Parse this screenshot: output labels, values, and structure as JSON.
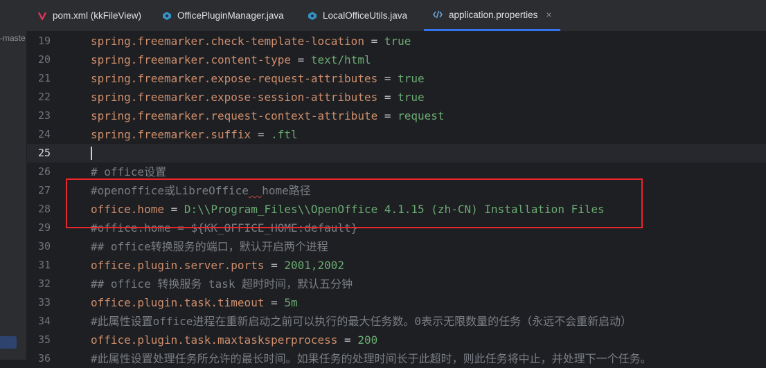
{
  "sidebar": {
    "project_label": "-maste"
  },
  "tabs": [
    {
      "label": "pom.xml (kkFileView)",
      "icon": "maven-icon",
      "active": false
    },
    {
      "label": "OfficePluginManager.java",
      "icon": "java-class-icon",
      "active": false
    },
    {
      "label": "LocalOfficeUtils.java",
      "icon": "java-class-icon",
      "active": false
    },
    {
      "label": "application.properties",
      "icon": "properties-file-icon",
      "active": true,
      "close": "×"
    }
  ],
  "editor": {
    "current_line": 25,
    "lines": [
      {
        "n": "19",
        "key": "spring.freemarker.check-template-location",
        "eq": " = ",
        "val": "true"
      },
      {
        "n": "20",
        "key": "spring.freemarker.content-type",
        "eq": " = ",
        "val": "text/html"
      },
      {
        "n": "21",
        "key": "spring.freemarker.expose-request-attributes",
        "eq": " = ",
        "val": "true"
      },
      {
        "n": "22",
        "key": "spring.freemarker.expose-session-attributes",
        "eq": " = ",
        "val": "true"
      },
      {
        "n": "23",
        "key": "spring.freemarker.request-context-attribute",
        "eq": " = ",
        "val": "request"
      },
      {
        "n": "24",
        "key": "spring.freemarker.suffix",
        "eq": " = ",
        "val": ".ftl"
      },
      {
        "n": "25",
        "key": "",
        "eq": "",
        "val": ""
      },
      {
        "n": "26",
        "comment": "# office设置"
      },
      {
        "n": "27",
        "comment_pre": "#openoffice或LibreOffice",
        "comment_sq": "  ",
        "comment_post": "home路径"
      },
      {
        "n": "28",
        "key": "office.home",
        "eq": " = ",
        "val": "D:\\\\Program_Files\\\\OpenOffice 4.1.15 (zh-CN) Installation Files"
      },
      {
        "n": "29",
        "comment": "#office.home = ${KK_OFFICE_HOME:default}"
      },
      {
        "n": "30",
        "comment": "## office转换服务的端口，默认开启两个进程"
      },
      {
        "n": "31",
        "key": "office.plugin.server.ports",
        "eq": " = ",
        "val": "2001,2002"
      },
      {
        "n": "32",
        "comment": "## office 转换服务 task 超时时间，默认五分钟"
      },
      {
        "n": "33",
        "key": "office.plugin.task.timeout",
        "eq": " = ",
        "val": "5m"
      },
      {
        "n": "34",
        "comment": "#此属性设置office进程在重新启动之前可以执行的最大任务数。0表示无限数量的任务（永远不会重新启动）"
      },
      {
        "n": "35",
        "key": "office.plugin.task.maxtasksperprocess",
        "eq": " = ",
        "val": "200"
      },
      {
        "n": "36",
        "comment": "#此属性设置处理任务所允许的最长时间。如果任务的处理时间长于此超时，则此任务将中止，并处理下一个任务。"
      }
    ]
  }
}
